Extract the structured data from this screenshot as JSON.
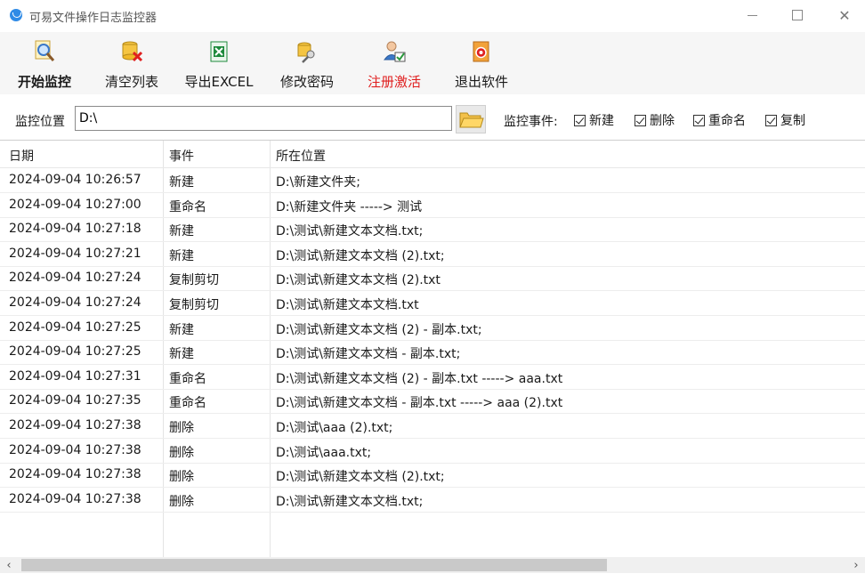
{
  "window": {
    "title": "可易文件操作日志监控器",
    "controls": {
      "minimize": "",
      "maximize": "",
      "close": "✕"
    }
  },
  "toolbar": {
    "buttons": [
      {
        "label": "开始监控",
        "icon": "magnifier-icon"
      },
      {
        "label": "清空列表",
        "icon": "clear-database-icon"
      },
      {
        "label": "导出EXCEL",
        "icon": "excel-icon"
      },
      {
        "label": "修改密码",
        "icon": "key-icon"
      },
      {
        "label": "注册激活",
        "icon": "user-check-icon"
      },
      {
        "label": "退出软件",
        "icon": "exit-icon"
      }
    ]
  },
  "path_bar": {
    "label": "监控位置",
    "value": "D:\\",
    "events_label": "监控事件:",
    "events": [
      {
        "label": "新建",
        "checked": true
      },
      {
        "label": "删除",
        "checked": true
      },
      {
        "label": "重命名",
        "checked": true
      },
      {
        "label": "复制",
        "checked": true
      }
    ]
  },
  "table": {
    "headers": [
      "日期",
      "事件",
      "所在位置"
    ],
    "rows": [
      [
        "2024-09-04 10:26:57",
        "新建",
        "D:\\新建文件夹;"
      ],
      [
        "2024-09-04 10:27:00",
        "重命名",
        "D:\\新建文件夹 -----> 测试"
      ],
      [
        "2024-09-04 10:27:18",
        "新建",
        "D:\\测试\\新建文本文档.txt;"
      ],
      [
        "2024-09-04 10:27:21",
        "新建",
        "D:\\测试\\新建文本文档 (2).txt;"
      ],
      [
        "2024-09-04 10:27:24",
        "复制剪切",
        "D:\\测试\\新建文本文档 (2).txt"
      ],
      [
        "2024-09-04 10:27:24",
        "复制剪切",
        "D:\\测试\\新建文本文档.txt"
      ],
      [
        "2024-09-04 10:27:25",
        "新建",
        "D:\\测试\\新建文本文档 (2) - 副本.txt;"
      ],
      [
        "2024-09-04 10:27:25",
        "新建",
        "D:\\测试\\新建文本文档 - 副本.txt;"
      ],
      [
        "2024-09-04 10:27:31",
        "重命名",
        "D:\\测试\\新建文本文档 (2) - 副本.txt -----> aaa.txt"
      ],
      [
        "2024-09-04 10:27:35",
        "重命名",
        "D:\\测试\\新建文本文档 - 副本.txt -----> aaa (2).txt"
      ],
      [
        "2024-09-04 10:27:38",
        "删除",
        "D:\\测试\\aaa (2).txt;"
      ],
      [
        "2024-09-04 10:27:38",
        "删除",
        "D:\\测试\\aaa.txt;"
      ],
      [
        "2024-09-04 10:27:38",
        "删除",
        "D:\\测试\\新建文本文档 (2).txt;"
      ],
      [
        "2024-09-04 10:27:38",
        "删除",
        "D:\\测试\\新建文本文档.txt;"
      ]
    ]
  },
  "scrollbar": {
    "left_arrow": "‹",
    "right_arrow": "›"
  },
  "colors": {
    "register_label": "#e02020",
    "excel_green": "#1e8a3c",
    "toolbar_bg": "#f6f6f6"
  }
}
